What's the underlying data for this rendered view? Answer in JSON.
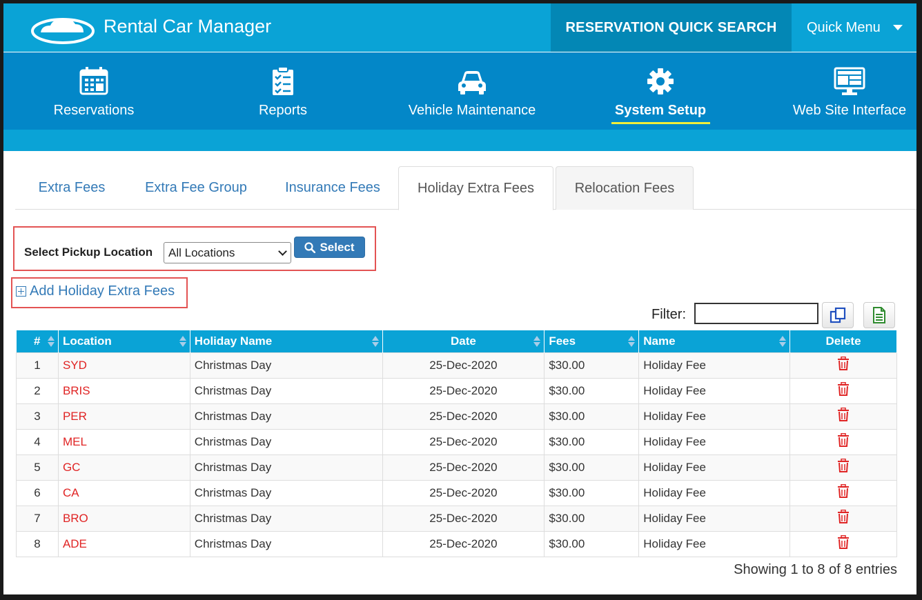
{
  "app": {
    "title": "Rental Car Manager"
  },
  "header": {
    "quick_search": "RESERVATION QUICK SEARCH",
    "quick_menu": "Quick Menu"
  },
  "nav": {
    "items": [
      {
        "label": "Reservations",
        "icon": "calendar-icon"
      },
      {
        "label": "Reports",
        "icon": "clipboard-checklist-icon"
      },
      {
        "label": "Vehicle Maintenance",
        "icon": "car-icon"
      },
      {
        "label": "System Setup",
        "icon": "gear-icon",
        "active": true
      },
      {
        "label": "Web Site Interface",
        "icon": "monitor-icon"
      }
    ],
    "active_underline_color": "#f2ee3a"
  },
  "tabs": [
    {
      "label": "Extra Fees"
    },
    {
      "label": "Extra Fee Group"
    },
    {
      "label": "Insurance Fees"
    },
    {
      "label": "Holiday Extra Fees",
      "active": true
    },
    {
      "label": "Relocation Fees"
    }
  ],
  "pickup": {
    "label": "Select Pickup Location",
    "selected": "All Locations",
    "button": "Select"
  },
  "add_link": "Add Holiday Extra Fees",
  "filter": {
    "label": "Filter:",
    "value": ""
  },
  "table": {
    "columns": [
      "#",
      "Location",
      "Holiday Name",
      "Date",
      "Fees",
      "Name",
      "Delete"
    ],
    "rows": [
      {
        "num": "1",
        "location": "SYD",
        "holiday": "Christmas Day",
        "date": "25-Dec-2020",
        "fees": "$30.00",
        "name": "Holiday Fee"
      },
      {
        "num": "2",
        "location": "BRIS",
        "holiday": "Christmas Day",
        "date": "25-Dec-2020",
        "fees": "$30.00",
        "name": "Holiday Fee"
      },
      {
        "num": "3",
        "location": "PER",
        "holiday": "Christmas Day",
        "date": "25-Dec-2020",
        "fees": "$30.00",
        "name": "Holiday Fee"
      },
      {
        "num": "4",
        "location": "MEL",
        "holiday": "Christmas Day",
        "date": "25-Dec-2020",
        "fees": "$30.00",
        "name": "Holiday Fee"
      },
      {
        "num": "5",
        "location": "GC",
        "holiday": "Christmas Day",
        "date": "25-Dec-2020",
        "fees": "$30.00",
        "name": "Holiday Fee"
      },
      {
        "num": "6",
        "location": "CA",
        "holiday": "Christmas Day",
        "date": "25-Dec-2020",
        "fees": "$30.00",
        "name": "Holiday Fee"
      },
      {
        "num": "7",
        "location": "BRO",
        "holiday": "Christmas Day",
        "date": "25-Dec-2020",
        "fees": "$30.00",
        "name": "Holiday Fee"
      },
      {
        "num": "8",
        "location": "ADE",
        "holiday": "Christmas Day",
        "date": "25-Dec-2020",
        "fees": "$30.00",
        "name": "Holiday Fee"
      }
    ]
  },
  "footer": {
    "showing": "Showing 1 to 8 of 8 entries"
  },
  "colors": {
    "header_bg": "#0aa3d6",
    "nav_bg": "#0387c8",
    "quick_search_bg": "#0387b5",
    "location_text": "#e02424",
    "highlight_box": "#e35353",
    "link": "#337ab7"
  }
}
